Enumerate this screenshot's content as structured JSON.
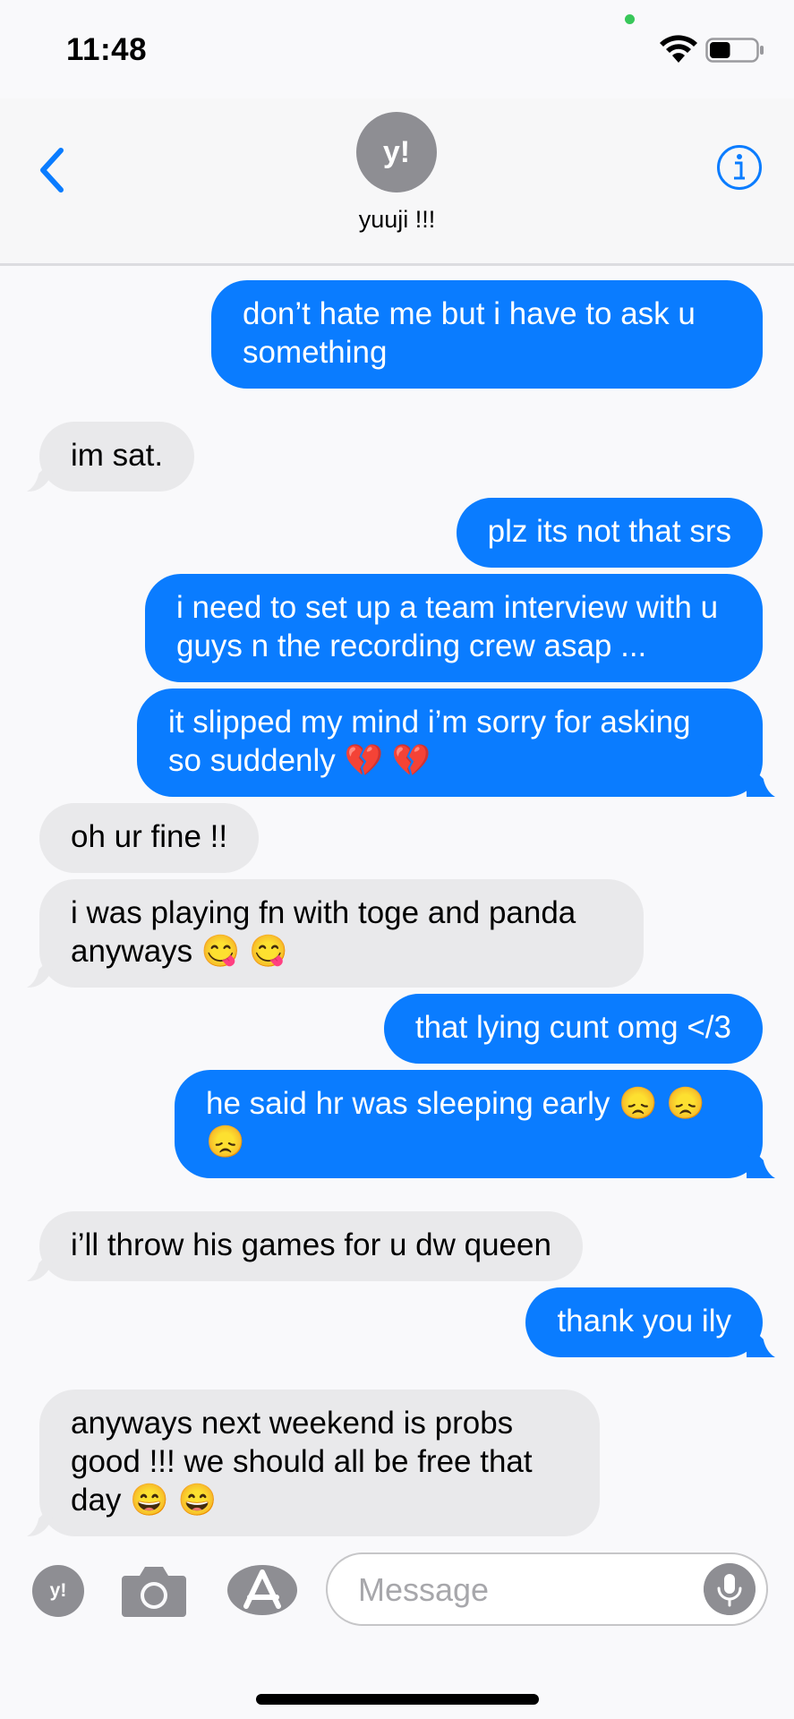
{
  "status_bar": {
    "time": "11:48",
    "battery_level": 0.45
  },
  "header": {
    "avatar_initials": "y!",
    "contact_name": "yuuji !!!",
    "accent_color": "#0a7cff"
  },
  "messages": [
    {
      "from": "me",
      "text": "don’t hate me but i have to ask u something"
    },
    {
      "from": "them",
      "text": "im sat."
    },
    {
      "from": "me",
      "text": "plz its not that srs"
    },
    {
      "from": "me",
      "text": "i need to set up a team interview with u guys n the recording crew asap ..."
    },
    {
      "from": "me",
      "text": "it slipped my mind i’m sorry for asking so suddenly 💔 💔"
    },
    {
      "from": "them",
      "text": "oh ur fine !!"
    },
    {
      "from": "them",
      "text": "i was playing fn with toge and panda anyways 😋 😋"
    },
    {
      "from": "me",
      "text": "that lying cunt omg </3"
    },
    {
      "from": "me",
      "text": "he said hr was sleeping early 😞 😞 😞"
    },
    {
      "from": "them",
      "text": "i’ll throw his games for u dw queen"
    },
    {
      "from": "me",
      "text": "thank you ily"
    },
    {
      "from": "them",
      "text": "anyways next weekend is probs good !!! we should all be free that day 😄 😄"
    }
  ],
  "input_bar": {
    "app_avatar_initials": "y!",
    "placeholder": "Message"
  },
  "icons": [
    "back-chevron-icon",
    "info-icon",
    "wifi-icon",
    "battery-icon",
    "camera-icon",
    "app-store-icon",
    "microphone-icon"
  ]
}
